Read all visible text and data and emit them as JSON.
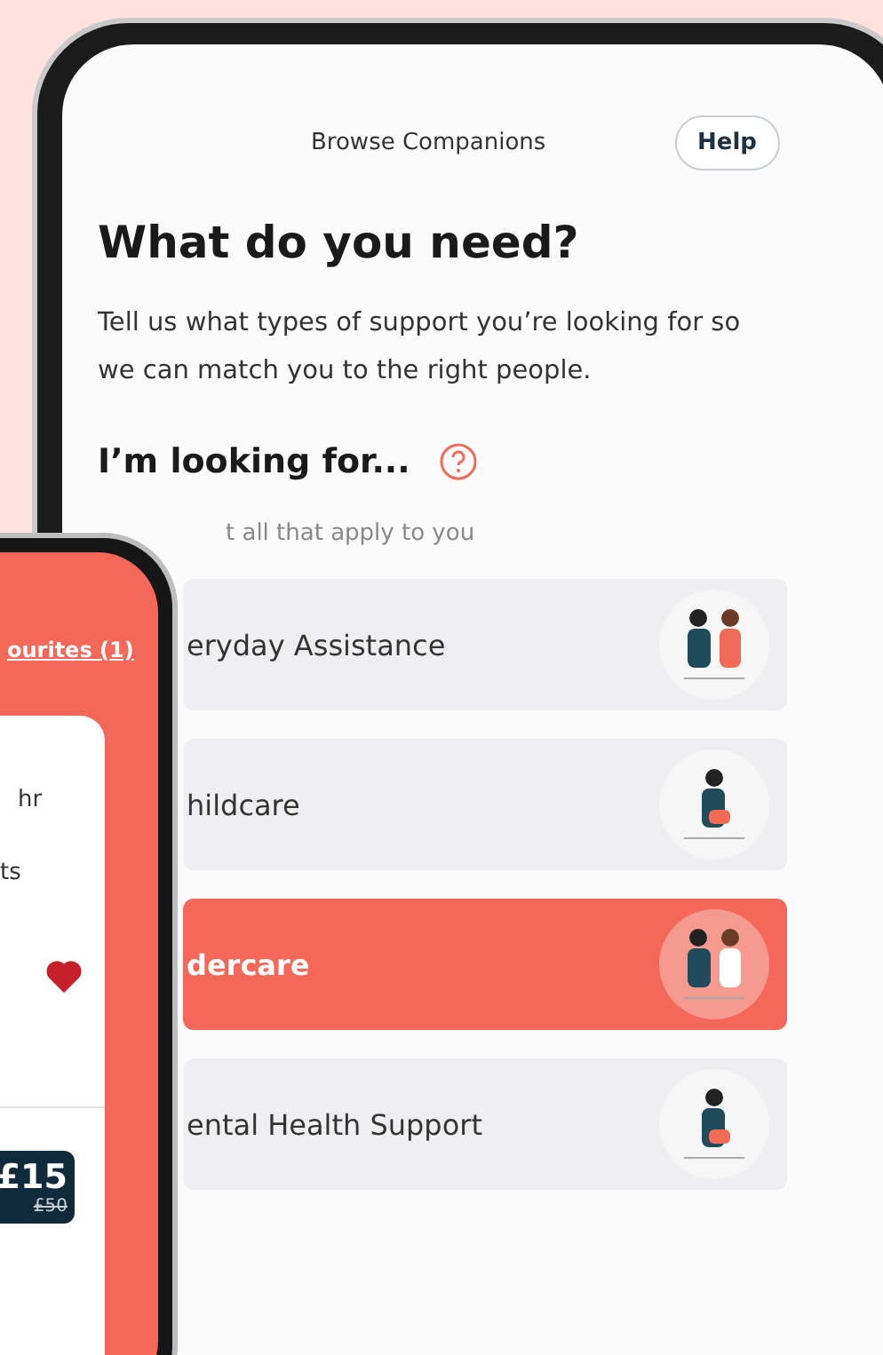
{
  "back_screen": {
    "header_title": "Browse Companions",
    "help_button": "Help",
    "title": "What do you need?",
    "description": "Tell us what types of support you’re looking for so we can match you to the right people.",
    "section_title": "I’m looking for...",
    "section_hint": "t all that apply to you",
    "options": [
      {
        "label": "eryday Assistance",
        "selected": false
      },
      {
        "label": "hildcare",
        "selected": false
      },
      {
        "label": "dercare",
        "selected": true
      },
      {
        "label": "ental Health Support",
        "selected": false
      }
    ]
  },
  "front_screen": {
    "link": "ourites (1)",
    "card": {
      "line_1": "hr",
      "line_2": "ts",
      "favourite": true,
      "price": "£15",
      "old_price": "£50"
    }
  }
}
